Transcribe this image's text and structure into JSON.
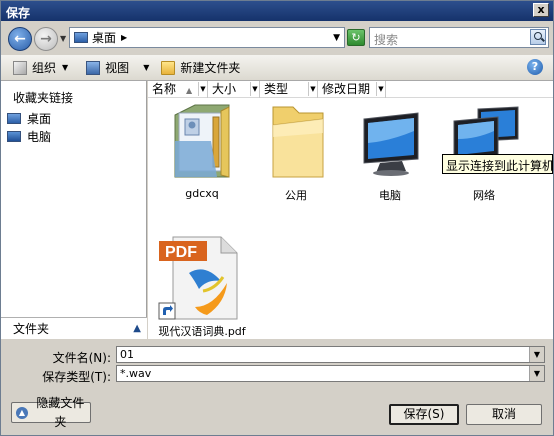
{
  "window": {
    "title": "保存",
    "close": "x"
  },
  "address": {
    "location": "桌面",
    "search_placeholder": "搜索"
  },
  "toolbar": {
    "organize": "组织",
    "view": "视图",
    "new_folder": "新建文件夹",
    "help": "?"
  },
  "sidebar": {
    "title": "收藏夹链接",
    "items": [
      {
        "label": "桌面",
        "icon": "desktop-icon"
      },
      {
        "label": "电脑",
        "icon": "computer-icon"
      }
    ],
    "folders_label": "文件夹"
  },
  "columns": [
    {
      "label": "名称"
    },
    {
      "label": "大小"
    },
    {
      "label": "类型"
    },
    {
      "label": "修改日期"
    }
  ],
  "files": [
    {
      "name": "gdcxq",
      "icon": "user-folder-icon"
    },
    {
      "name": "公用",
      "icon": "folder-icon"
    },
    {
      "name": "电脑",
      "icon": "computer-icon"
    },
    {
      "name": "网络",
      "icon": "network-icon"
    },
    {
      "name": "现代汉语词典.pdf",
      "icon": "pdf-shortcut-icon"
    }
  ],
  "tooltip": "显示连接到此计算机的驱",
  "form": {
    "filename_label": "文件名(N):",
    "filename_value": "01",
    "filetype_label": "保存类型(T):",
    "filetype_value": "*.wav"
  },
  "buttons": {
    "hide_folders": "隐藏文件夹",
    "save": "保存(S)",
    "cancel": "取消"
  }
}
